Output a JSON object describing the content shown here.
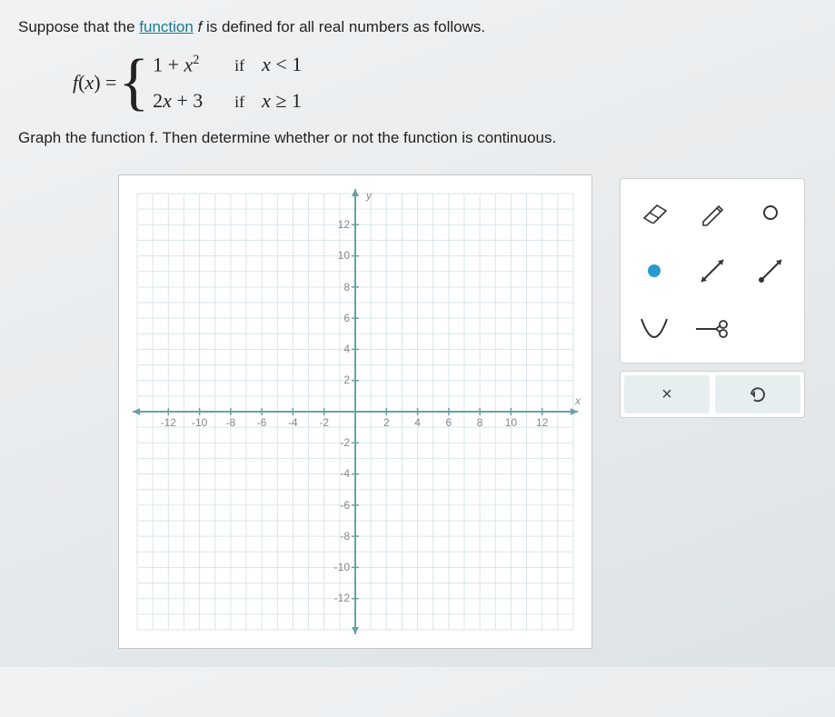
{
  "prompt": {
    "prefix": "Suppose that the ",
    "link_text": "function",
    "suffix": " f is defined for all real numbers as follows."
  },
  "formula": {
    "lhs": "f(x) =",
    "cases": [
      {
        "expr": "1 + x",
        "sup": "2",
        "if": "if",
        "cond": "x < 1"
      },
      {
        "expr": "2x + 3",
        "sup": "",
        "if": "if",
        "cond": "x ≥ 1"
      }
    ]
  },
  "instruction": "Graph the function f. Then determine whether or not the function is continuous.",
  "graph": {
    "x_ticks": [
      "-12",
      "-10",
      "-8",
      "-6",
      "-4",
      "-2",
      "2",
      "4",
      "6",
      "8",
      "10",
      "12"
    ],
    "y_ticks": [
      "12",
      "10",
      "8",
      "6",
      "4",
      "2",
      "-2",
      "-4",
      "-6",
      "-8",
      "-10",
      "-12"
    ],
    "x_label": "x",
    "y_label": "y"
  },
  "tools": {
    "eraser": "eraser",
    "pencil": "pencil",
    "open_point": "open-point",
    "closed_point": "closed-point",
    "line_segment": "line-segment",
    "ray": "ray",
    "parabola": "parabola",
    "scissors_line": "scissors-line"
  },
  "actions": {
    "clear": "×",
    "undo": "↺"
  },
  "chart_data": {
    "type": "line",
    "title": "",
    "xlabel": "x",
    "ylabel": "y",
    "xlim": [
      -14,
      14
    ],
    "ylim": [
      -14,
      14
    ],
    "x_ticks": [
      -12,
      -10,
      -8,
      -6,
      -4,
      -2,
      2,
      4,
      6,
      8,
      10,
      12
    ],
    "y_ticks": [
      -12,
      -10,
      -8,
      -6,
      -4,
      -2,
      2,
      4,
      6,
      8,
      10,
      12
    ],
    "series": []
  }
}
